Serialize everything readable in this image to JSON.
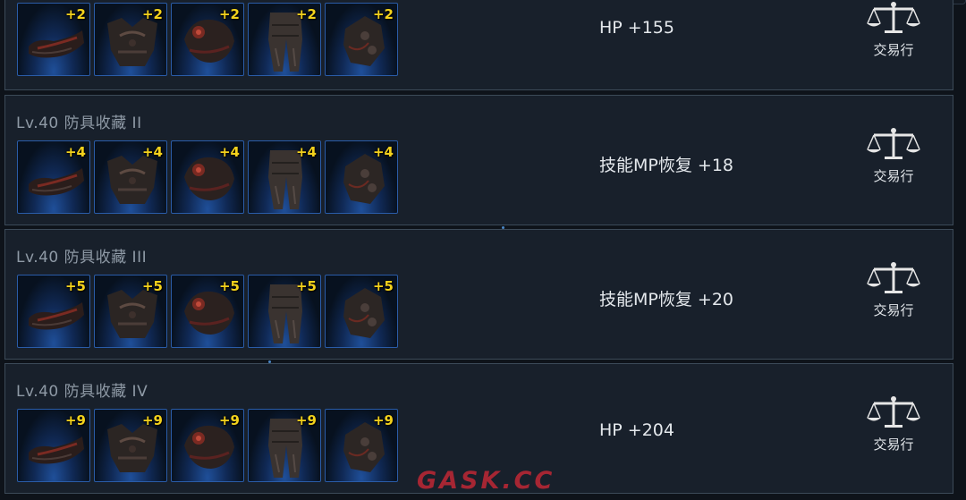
{
  "trade_label": "交易行",
  "rows": [
    {
      "title": "",
      "bonus_label": "HP",
      "bonus_value": "+155",
      "items": [
        {
          "name": "shoulder-armor",
          "level": "+2"
        },
        {
          "name": "chest-armor",
          "level": "+2"
        },
        {
          "name": "gauntlet-armor",
          "level": "+2"
        },
        {
          "name": "leg-armor",
          "level": "+2"
        },
        {
          "name": "boot-armor",
          "level": "+2"
        }
      ]
    },
    {
      "title": "Lv.40 防具收藏 II",
      "bonus_label": "技能MP恢复",
      "bonus_value": "+18",
      "items": [
        {
          "name": "shoulder-armor",
          "level": "+4"
        },
        {
          "name": "chest-armor",
          "level": "+4"
        },
        {
          "name": "gauntlet-armor",
          "level": "+4"
        },
        {
          "name": "leg-armor",
          "level": "+4"
        },
        {
          "name": "boot-armor",
          "level": "+4"
        }
      ]
    },
    {
      "title": "Lv.40 防具收藏 III",
      "bonus_label": "技能MP恢复",
      "bonus_value": "+20",
      "items": [
        {
          "name": "shoulder-armor",
          "level": "+5"
        },
        {
          "name": "chest-armor",
          "level": "+5"
        },
        {
          "name": "gauntlet-armor",
          "level": "+5"
        },
        {
          "name": "leg-armor",
          "level": "+5"
        },
        {
          "name": "boot-armor",
          "level": "+5"
        }
      ]
    },
    {
      "title": "Lv.40 防具收藏 IV",
      "bonus_label": "HP",
      "bonus_value": "+204",
      "items": [
        {
          "name": "shoulder-armor",
          "level": "+9"
        },
        {
          "name": "chest-armor",
          "level": "+9"
        },
        {
          "name": "gauntlet-armor",
          "level": "+9"
        },
        {
          "name": "leg-armor",
          "level": "+9"
        },
        {
          "name": "boot-armor",
          "level": "+9"
        }
      ]
    }
  ],
  "watermark": "GASK.CC",
  "colors": {
    "level_badge": "#f4d21c",
    "slot_border": "#2a5ca8",
    "watermark": "#d62837"
  },
  "icons": [
    "shoulder-armor-icon",
    "chest-armor-icon",
    "gauntlet-armor-icon",
    "leg-armor-icon",
    "boot-armor-icon",
    "scale-icon"
  ]
}
